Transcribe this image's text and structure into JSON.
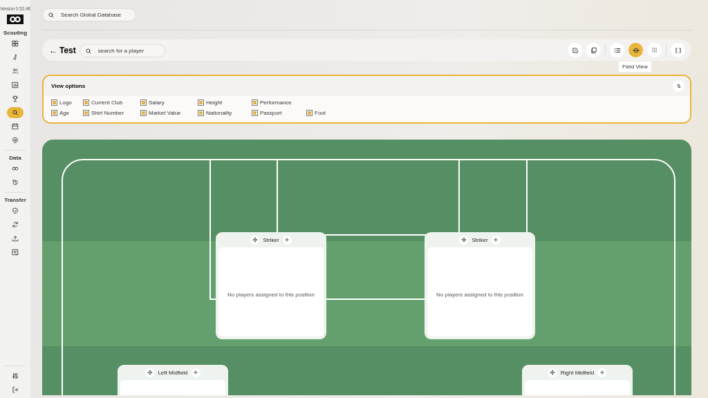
{
  "sidebar": {
    "version": "Version 0.52.4€",
    "sections": [
      {
        "title": "Scouting",
        "items": [
          {
            "selected": false
          },
          {
            "selected": false
          },
          {
            "selected": false
          },
          {
            "selected": false
          },
          {
            "selected": false
          },
          {
            "selected": true
          },
          {
            "selected": false
          },
          {
            "selected": false
          }
        ]
      },
      {
        "title": "Data",
        "items": [
          {
            "selected": false
          },
          {
            "selected": false
          }
        ]
      },
      {
        "title": "Transfer",
        "items": [
          {
            "selected": false
          },
          {
            "selected": false
          },
          {
            "selected": false
          },
          {
            "selected": false
          }
        ]
      }
    ],
    "footer_items": [
      {
        "selected": false
      },
      {
        "selected": false
      }
    ]
  },
  "global_search": {
    "placeholder": "Search Global Database"
  },
  "toolbar": {
    "back": "←",
    "title": "Test",
    "search": {
      "placeholder": "search for a player"
    },
    "groups": [
      [
        {
          "selected": false
        },
        {
          "selected": false
        }
      ],
      [
        {
          "selected": false
        },
        {
          "selected": true,
          "tooltip": "Field View"
        },
        {
          "selected": false
        }
      ],
      [
        {
          "selected": false
        }
      ]
    ]
  },
  "view_options": {
    "title": "View options",
    "collapse": "⇅",
    "rows": [
      [
        {
          "label": "Logo",
          "checked": true
        },
        {
          "label": "Current Club",
          "checked": true
        },
        {
          "label": "Salary",
          "checked": true
        },
        {
          "label": "Height",
          "checked": true
        },
        {
          "label": "Performance",
          "checked": true
        }
      ],
      [
        {
          "label": "Age",
          "checked": true
        },
        {
          "label": "Shirt Number",
          "checked": true
        },
        {
          "label": "Market Value",
          "checked": true
        },
        {
          "label": "Nationality",
          "checked": true
        },
        {
          "label": "Passport",
          "checked": true
        },
        {
          "label": "Foot",
          "checked": true
        }
      ]
    ]
  },
  "positions": [
    {
      "name": "Striker",
      "empty_text": "No players assigned to this position"
    },
    {
      "name": "Striker",
      "empty_text": "No players assigned to this position"
    },
    {
      "name": "Left Midfield"
    },
    {
      "name": "Right Midfield"
    }
  ]
}
